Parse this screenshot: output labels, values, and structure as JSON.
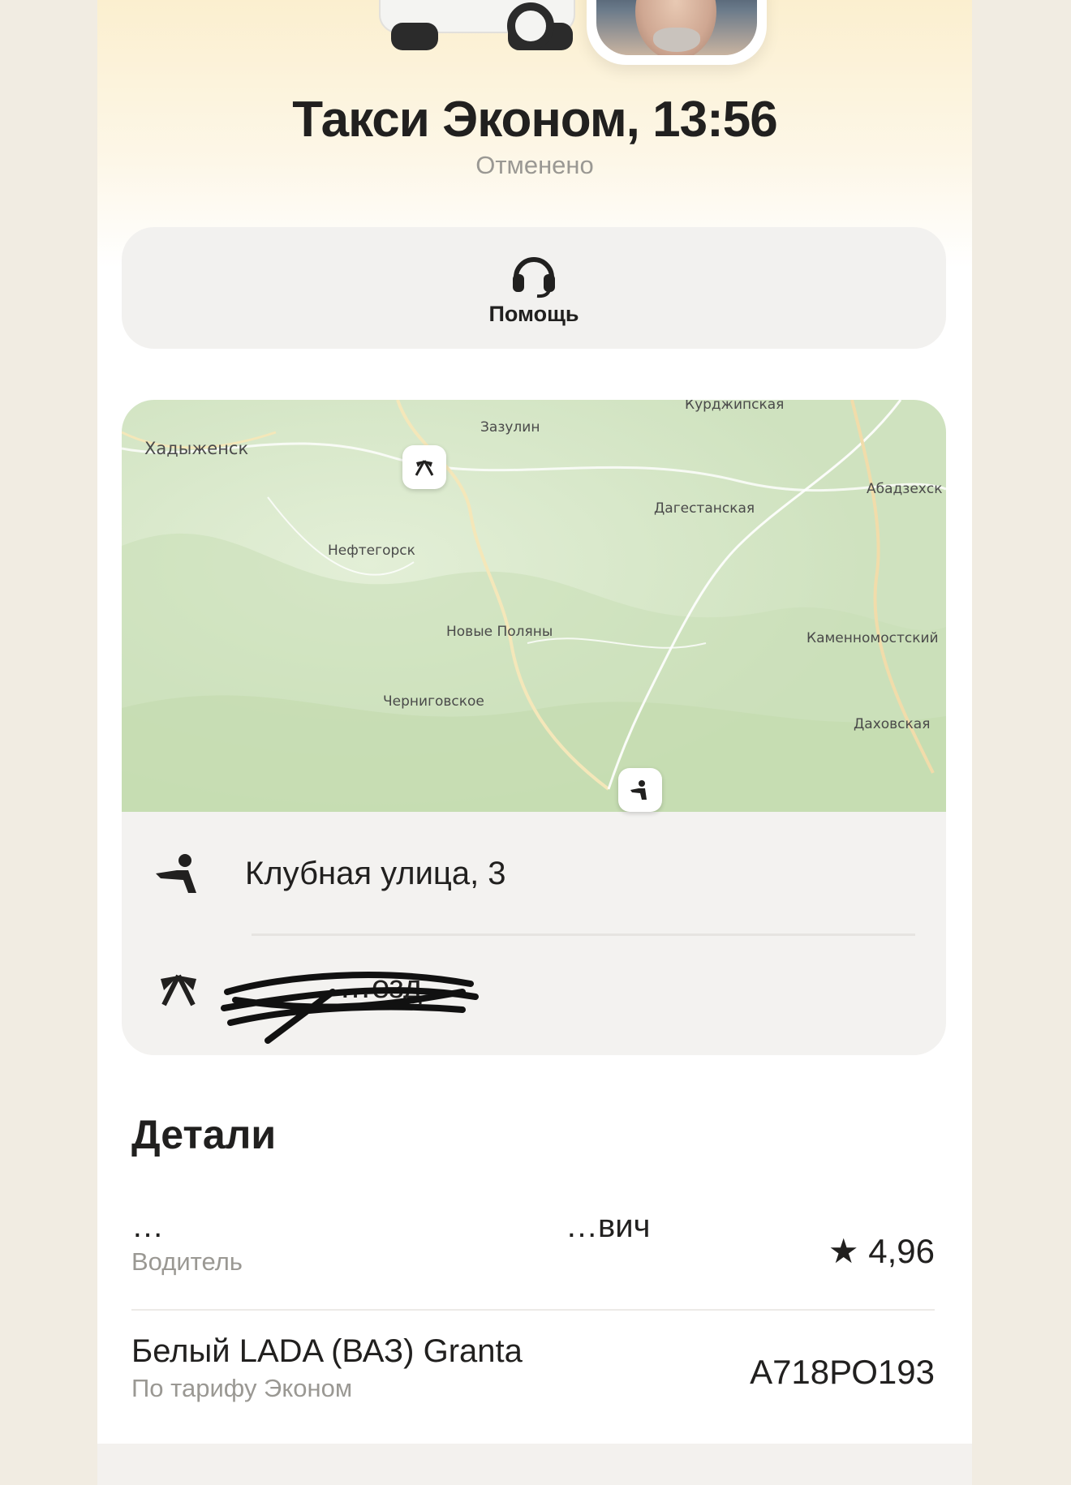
{
  "header": {
    "title": "Такси Эконом, 13:56",
    "status": "Отменено"
  },
  "help": {
    "label": "Помощь",
    "icon": "headset-icon"
  },
  "map": {
    "labels": [
      "Курджипская",
      "Хадыженск",
      "Зазулин",
      "Абадзехск",
      "Дагестанская",
      "Нефтегорск",
      "Новые Поляны",
      "Каменномостский",
      "Черниговское",
      "Даховская"
    ]
  },
  "route": {
    "pickup": "Клубная улица, 3",
    "destination": "…езд"
  },
  "details": {
    "heading": "Детали",
    "driver": {
      "name_left": "…",
      "name_right": "…вич",
      "role": "Водитель",
      "rating": "★ 4,96"
    },
    "car": {
      "model": "Белый LADA (ВАЗ) Granta",
      "tariff": "По тарифу Эконом",
      "plate": "А718РО193"
    }
  },
  "colors": {
    "header_gradient": "#fbefcf",
    "card_bg": "#f2f1ef",
    "secondary_text": "#9a9893",
    "map_green": "#d6e8c8"
  }
}
